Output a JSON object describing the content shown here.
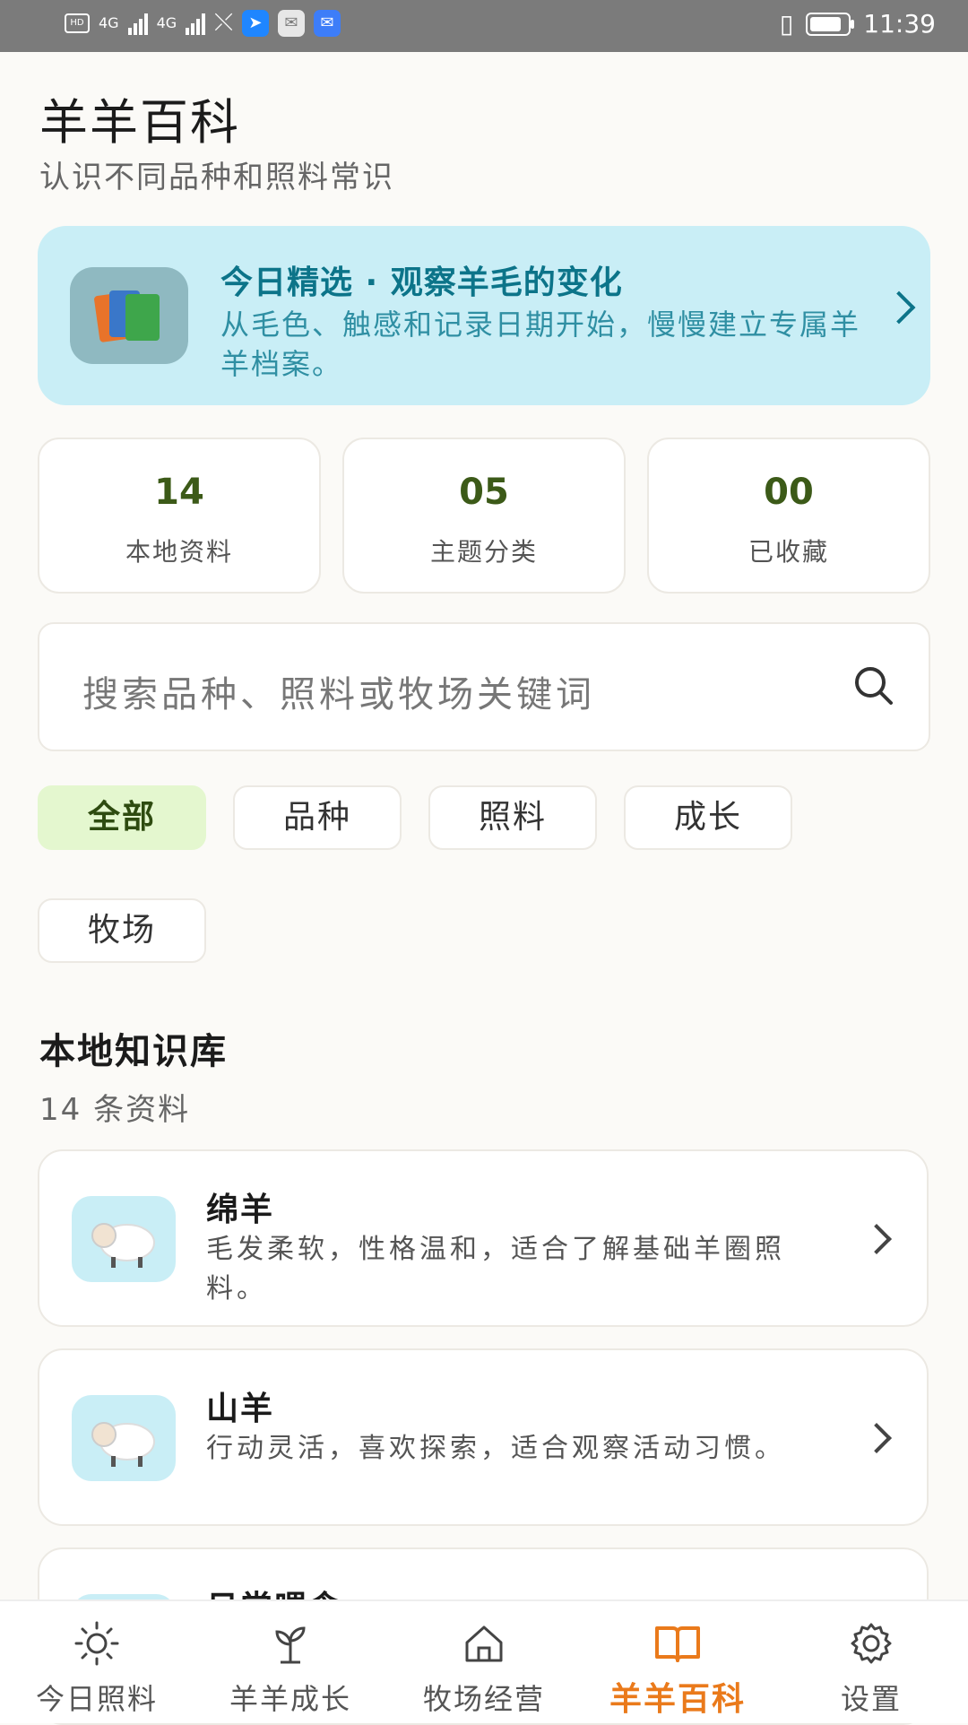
{
  "status_bar": {
    "time": "11:39",
    "network_left": "4G",
    "network_right": "4G"
  },
  "header": {
    "title": "羊羊百科",
    "subtitle": "认识不同品种和照料常识"
  },
  "featured": {
    "title": "今日精选 · 观察羊毛的变化",
    "description": "从毛色、触感和记录日期开始，慢慢建立专属羊羊档案。",
    "icon": "books-icon"
  },
  "stats": [
    {
      "value": "14",
      "label": "本地资料"
    },
    {
      "value": "05",
      "label": "主题分类"
    },
    {
      "value": "00",
      "label": "已收藏"
    }
  ],
  "search": {
    "placeholder": "搜索品种、照料或牧场关键词"
  },
  "filters": [
    {
      "label": "全部",
      "selected": true
    },
    {
      "label": "品种",
      "selected": false
    },
    {
      "label": "照料",
      "selected": false
    },
    {
      "label": "成长",
      "selected": false
    },
    {
      "label": "牧场",
      "selected": false
    }
  ],
  "section": {
    "title": "本地知识库",
    "count": "14 条资料"
  },
  "items": [
    {
      "title": "绵羊",
      "description": "毛发柔软，性格温和，适合了解基础羊圈照料。",
      "icon": "sheep-icon"
    },
    {
      "title": "山羊",
      "description": "行动灵活，喜欢探索，适合观察活动习惯。",
      "icon": "sheep-icon"
    },
    {
      "title": "日常喂食",
      "description": "",
      "icon": "sheep-icon"
    }
  ],
  "nav": [
    {
      "label": "今日照料",
      "icon": "sun-icon"
    },
    {
      "label": "羊羊成长",
      "icon": "sprout-icon"
    },
    {
      "label": "牧场经营",
      "icon": "home-icon"
    },
    {
      "label": "羊羊百科",
      "icon": "book-icon",
      "active": true
    },
    {
      "label": "设置",
      "icon": "gear-icon"
    }
  ],
  "colors": {
    "accent": "#ea7a1b",
    "featured_bg": "#c9eef6",
    "chip_active_bg": "#e4f7cf",
    "stat_value": "#3c5a18"
  }
}
